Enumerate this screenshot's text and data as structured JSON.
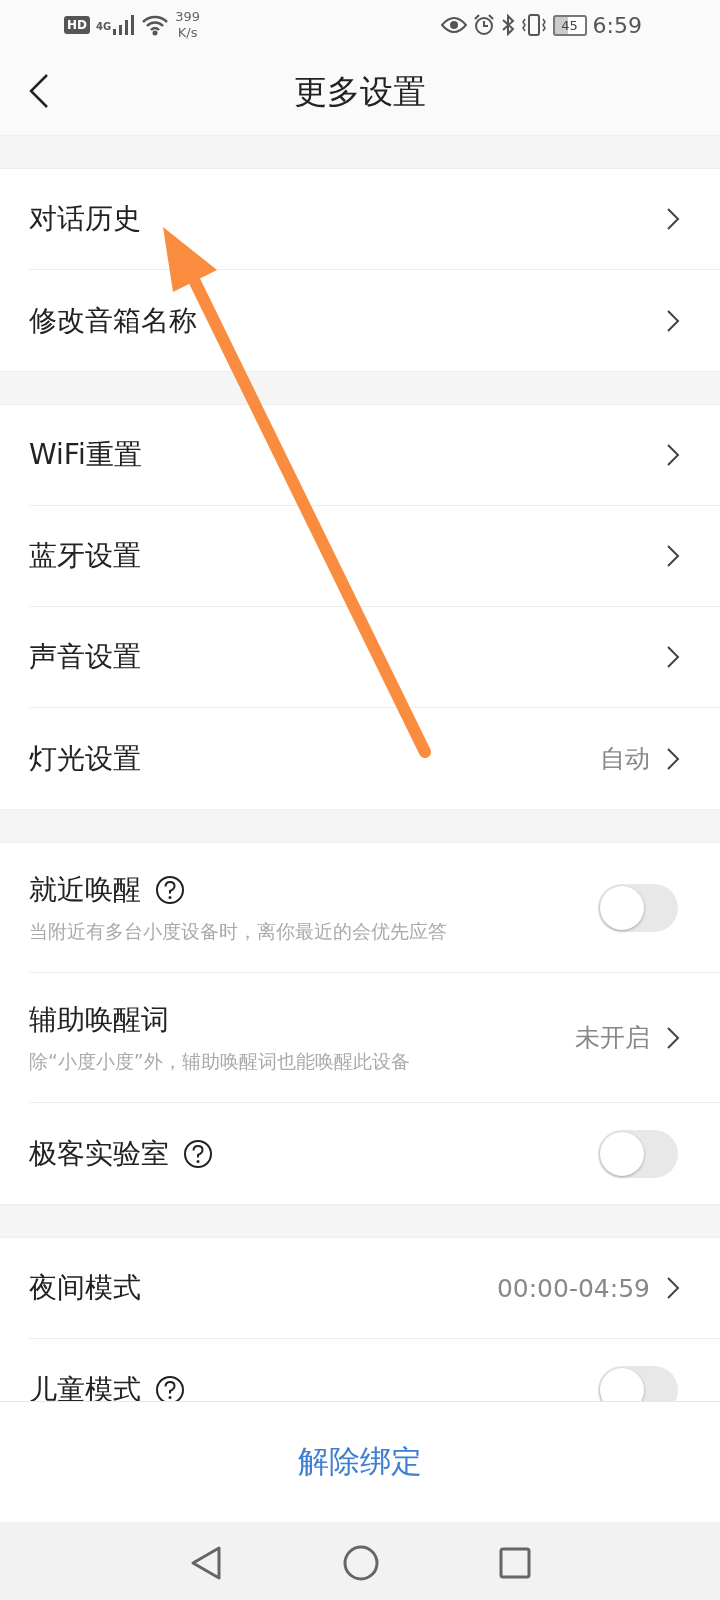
{
  "status_bar": {
    "hd": "HD",
    "network": "4G",
    "speed_value": "399",
    "speed_unit": "K/s",
    "battery": "45",
    "time": "6:59"
  },
  "header": {
    "title": "更多设置"
  },
  "groups": [
    {
      "items": [
        {
          "kind": "link",
          "label": "对话历史"
        },
        {
          "kind": "link",
          "label": "修改音箱名称"
        }
      ]
    },
    {
      "items": [
        {
          "kind": "link",
          "label": "WiFi重置"
        },
        {
          "kind": "link",
          "label": "蓝牙设置"
        },
        {
          "kind": "link",
          "label": "声音设置"
        },
        {
          "kind": "link",
          "label": "灯光设置",
          "value": "自动"
        }
      ]
    },
    {
      "items": [
        {
          "kind": "toggle",
          "label": "就近唤醒",
          "help": true,
          "description": "当附近有多台小度设备时，离你最近的会优先应答",
          "on": false
        },
        {
          "kind": "link",
          "label": "辅助唤醒词",
          "description": "除“小度小度”外，辅助唤醒词也能唤醒此设备",
          "value": "未开启"
        },
        {
          "kind": "toggle",
          "label": "极客实验室",
          "help": true,
          "on": false
        }
      ]
    },
    {
      "items": [
        {
          "kind": "link",
          "label": "夜间模式",
          "value": "00:00-04:59"
        },
        {
          "kind": "toggle",
          "label": "儿童模式",
          "help": true,
          "on": false
        }
      ]
    }
  ],
  "footer": {
    "button": "解除绑定"
  }
}
